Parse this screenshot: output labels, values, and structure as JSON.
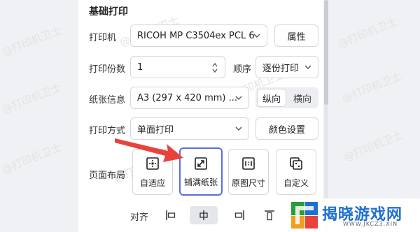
{
  "section": {
    "title": "基础打印"
  },
  "printer": {
    "label": "打印机",
    "value": "RICOH MP C3504ex PCL 6",
    "button": "属性"
  },
  "copies": {
    "label": "打印份数",
    "value": "1",
    "order_label": "顺序",
    "order_value": "逐份打印"
  },
  "paper": {
    "label": "纸张信息",
    "value": "A3 (297 x 420 mm) ...",
    "portrait": "纵向",
    "landscape": "横向"
  },
  "mode": {
    "label": "打印方式",
    "value": "单面打印",
    "color_button": "颜色设置"
  },
  "layout": {
    "label": "页面布局",
    "options": [
      {
        "label": "自适应",
        "icon": "adaptive-icon"
      },
      {
        "label": "铺满纸张",
        "icon": "fill-paper-icon",
        "selected": true
      },
      {
        "label": "原图尺寸",
        "icon": "original-size-icon"
      },
      {
        "label": "自定义",
        "icon": "custom-layout-icon"
      }
    ]
  },
  "align": {
    "label": "对齐",
    "options": [
      "align-left",
      "align-center",
      "align-right",
      "align-top"
    ],
    "selected": "align-center"
  },
  "watermark": {
    "text": "@打印机卫士"
  },
  "site_logo": {
    "name": "揭晓游戏网",
    "url": "WWW.JKCZ3.XIN"
  },
  "colors": {
    "accent": "#5a6ee0",
    "arrow": "#e8423b"
  }
}
